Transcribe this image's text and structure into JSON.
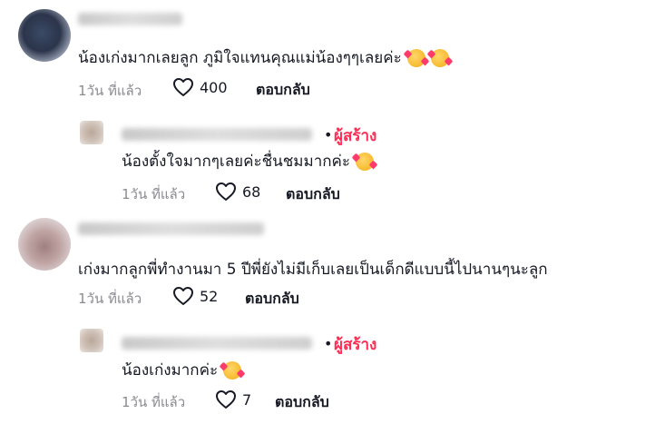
{
  "comments": [
    {
      "text": "น้องเก่งมากเลยลูก ภูมิใจแทนคุณแม่น้องๆๆเลยค่ะ",
      "time": "1วัน ที่แล้ว",
      "likes": "400",
      "reply_label": "ตอบกลับ",
      "emoji_count": 2,
      "reply": {
        "creator_label": "ผู้สร้าง",
        "separator": "•",
        "text": "น้องตั้งใจมากๆเลยค่ะชื่นชมมากค่ะ",
        "time": "1วัน ที่แล้ว",
        "likes": "68",
        "reply_label": "ตอบกลับ"
      }
    },
    {
      "text": "เก่งมากลูกพี่ทำงานมา 5 ปีพี่ยังไม่มีเก็บเลยเป็นเด็กดีแบบนี้ไปนานๆนะลูก",
      "time": "1วัน ที่แล้ว",
      "likes": "52",
      "reply_label": "ตอบกลับ",
      "reply": {
        "creator_label": "ผู้สร้าง",
        "separator": "•",
        "text": "น้องเก่งมากค่ะ",
        "time": "1วัน ที่แล้ว",
        "likes": "7",
        "reply_label": "ตอบกลับ"
      }
    }
  ],
  "icons": {
    "like": "heart-outline-icon",
    "emoji": "smiling-face-with-hearts-icon"
  },
  "colors": {
    "creator": "#fe2c55",
    "meta": "#8a8b91",
    "text": "#161823"
  }
}
